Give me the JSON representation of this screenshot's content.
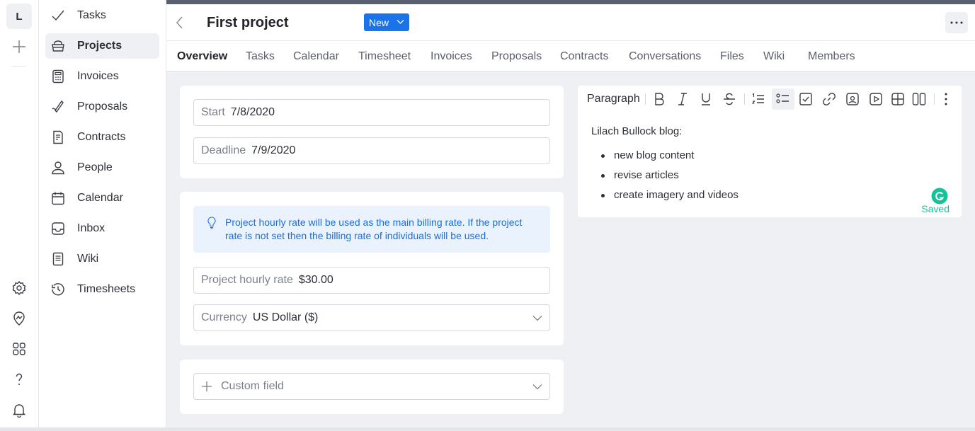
{
  "rail": {
    "avatar": "L",
    "icons": [
      "plus-icon",
      "settings-gear-icon",
      "location-pin-icon",
      "apps-grid-icon",
      "help-question-icon",
      "notification-bell-icon"
    ]
  },
  "sidebar": {
    "items": [
      {
        "label": "Tasks",
        "icon": "check-icon"
      },
      {
        "label": "Projects",
        "icon": "basket-icon",
        "active": true
      },
      {
        "label": "Invoices",
        "icon": "calculator-icon"
      },
      {
        "label": "Proposals",
        "icon": "pen-icon"
      },
      {
        "label": "Contracts",
        "icon": "contract-icon"
      },
      {
        "label": "People",
        "icon": "person-icon"
      },
      {
        "label": "Calendar",
        "icon": "calendar-icon"
      },
      {
        "label": "Inbox",
        "icon": "inbox-icon"
      },
      {
        "label": "Wiki",
        "icon": "document-icon"
      },
      {
        "label": "Timesheets",
        "icon": "clock-icon"
      }
    ]
  },
  "header": {
    "title": "First project",
    "status": "New",
    "accent": "#1a73e8"
  },
  "tabs": [
    "Overview",
    "Tasks",
    "Calendar",
    "Timesheet",
    "Invoices",
    "Proposals",
    "Contracts",
    "Conversations",
    "Files",
    "Wiki",
    "Members"
  ],
  "dates": {
    "start_label": "Start",
    "start_value": "7/8/2020",
    "deadline_label": "Deadline",
    "deadline_value": "7/9/2020"
  },
  "billing": {
    "info": "Project hourly rate will be used as the main billing rate. If the project rate is not set then the billing rate of individuals will be used.",
    "rate_label": "Project hourly rate",
    "rate_value": "$30.00",
    "currency_label": "Currency",
    "currency_value": "US Dollar ($)"
  },
  "custom_field": {
    "label": "Custom field"
  },
  "editor": {
    "block_type": "Paragraph",
    "intro": "Lilach Bullock blog:",
    "bullets": [
      "new blog content",
      "revise articles",
      "create imagery and videos"
    ],
    "saved": "Saved",
    "saved_color": "#15c39a"
  }
}
